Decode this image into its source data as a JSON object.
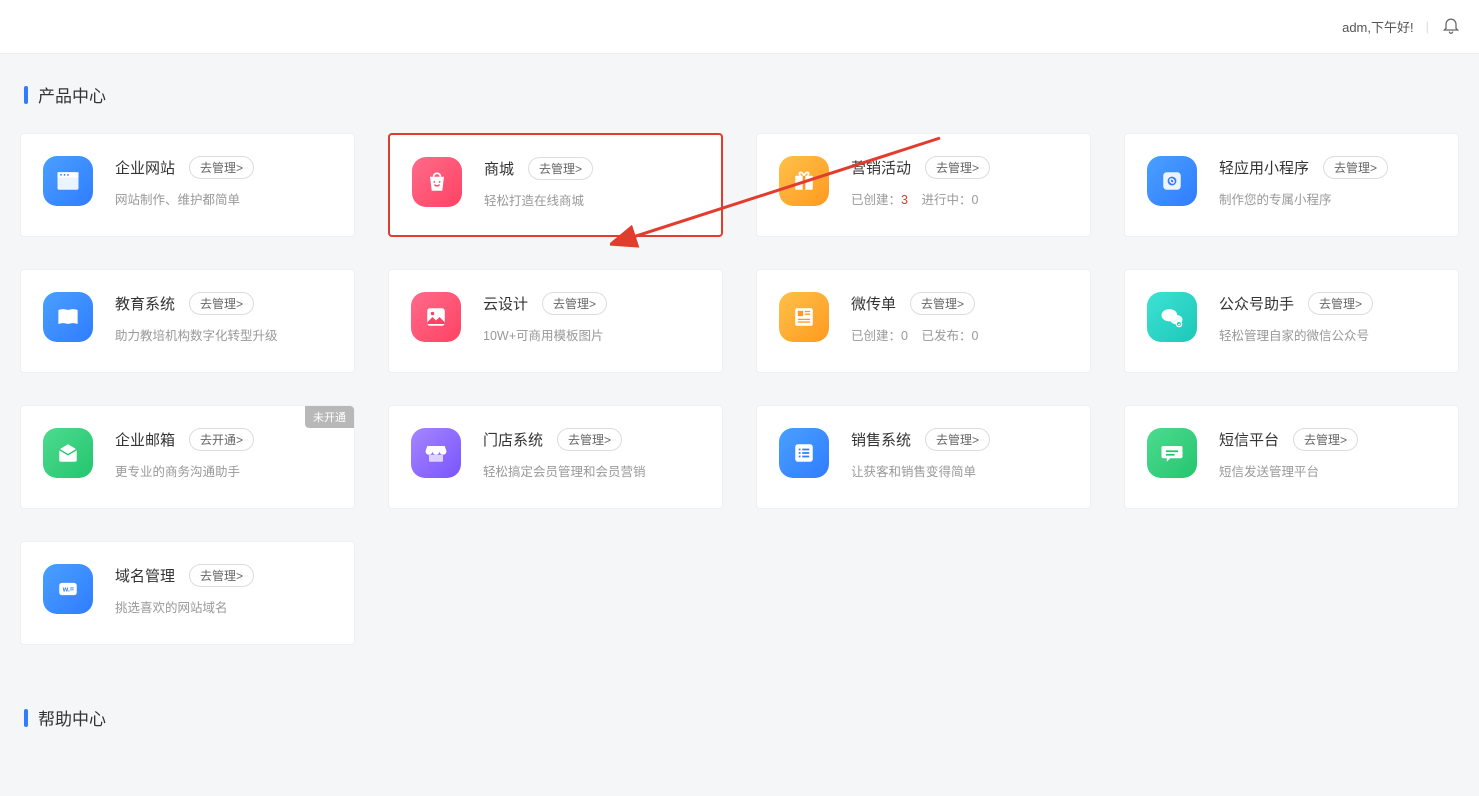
{
  "header": {
    "greeting": "adm,下午好!"
  },
  "sections": {
    "product_center": "产品中心",
    "help_center": "帮助中心"
  },
  "badges": {
    "not_opened": "未开通"
  },
  "cards": [
    {
      "id": "site",
      "title": "企业网站",
      "btn": "去管理>",
      "desc": "网站制作、维护都简单"
    },
    {
      "id": "mall",
      "title": "商城",
      "btn": "去管理>",
      "desc": "轻松打造在线商城"
    },
    {
      "id": "marketing",
      "title": "营销活动",
      "btn": "去管理>",
      "stat1_label": "已创建：",
      "stat1_value": "3",
      "stat2_label": "进行中：",
      "stat2_value": "0"
    },
    {
      "id": "miniapp",
      "title": "轻应用小程序",
      "btn": "去管理>",
      "desc": "制作您的专属小程序"
    },
    {
      "id": "edu",
      "title": "教育系统",
      "btn": "去管理>",
      "desc": "助力教培机构数字化转型升级"
    },
    {
      "id": "design",
      "title": "云设计",
      "btn": "去管理>",
      "desc": "10W+可商用模板图片"
    },
    {
      "id": "flyer",
      "title": "微传单",
      "btn": "去管理>",
      "stat1_label": "已创建：",
      "stat1_value": "0",
      "stat2_label": "已发布：",
      "stat2_value": "0"
    },
    {
      "id": "mp",
      "title": "公众号助手",
      "btn": "去管理>",
      "desc": "轻松管理自家的微信公众号"
    },
    {
      "id": "mail",
      "title": "企业邮箱",
      "btn": "去开通>",
      "desc": "更专业的商务沟通助手"
    },
    {
      "id": "store",
      "title": "门店系统",
      "btn": "去管理>",
      "desc": "轻松搞定会员管理和会员营销"
    },
    {
      "id": "sales",
      "title": "销售系统",
      "btn": "去管理>",
      "desc": "让获客和销售变得简单"
    },
    {
      "id": "sms",
      "title": "短信平台",
      "btn": "去管理>",
      "desc": "短信发送管理平台"
    },
    {
      "id": "domain",
      "title": "域名管理",
      "btn": "去管理>",
      "desc": "挑选喜欢的网站域名"
    }
  ]
}
